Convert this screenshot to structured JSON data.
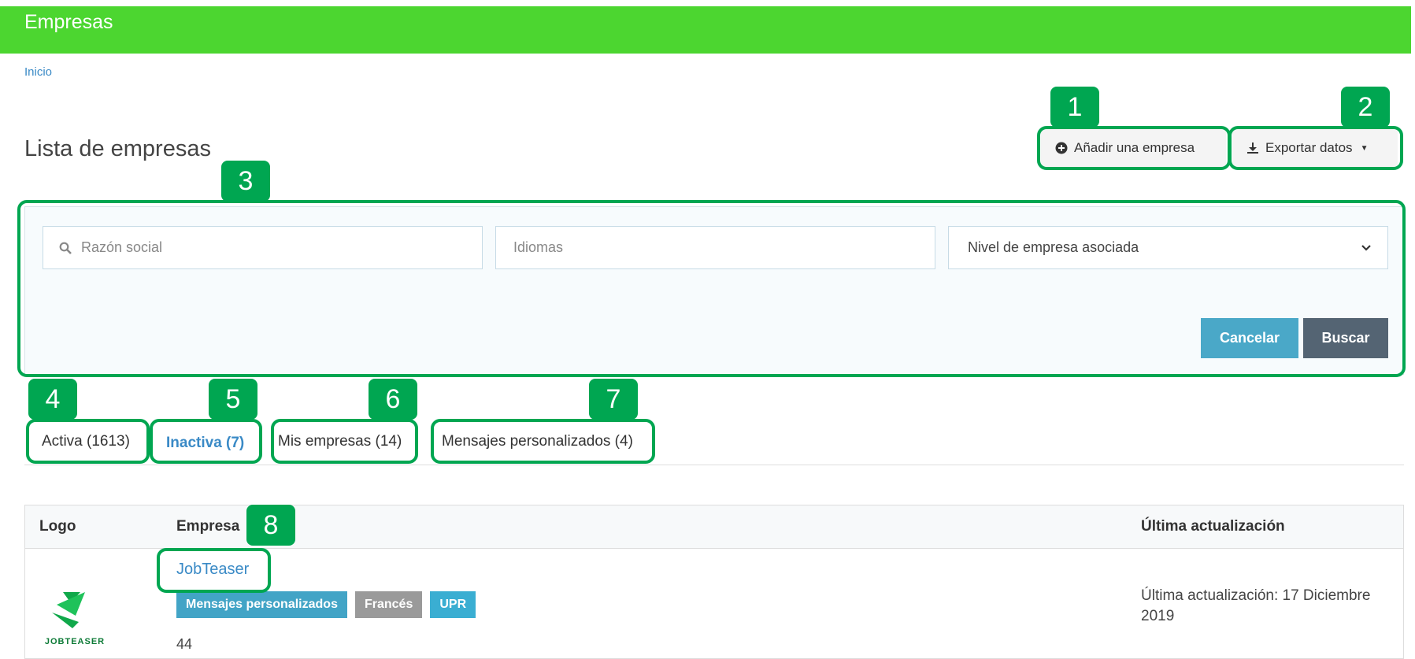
{
  "header": {
    "title": "Empresas"
  },
  "breadcrumb": {
    "home": "Inicio"
  },
  "page": {
    "title": "Lista de empresas"
  },
  "actions": {
    "add_label": "Añadir una empresa",
    "export_label": "Exportar datos"
  },
  "filters": {
    "search_placeholder": "Razón social",
    "languages_placeholder": "Idiomas",
    "level_placeholder": "Nivel de empresa asociada",
    "cancel_label": "Cancelar",
    "search_label": "Buscar"
  },
  "tabs": [
    {
      "label": "Activa (1613)"
    },
    {
      "label": "Inactiva (7)"
    },
    {
      "label": "Mis empresas (14)"
    },
    {
      "label": "Mensajes personalizados (4)"
    }
  ],
  "table": {
    "headers": {
      "logo": "Logo",
      "company": "Empresa",
      "updated": "Última actualización"
    },
    "rows": [
      {
        "company": "JobTeaser",
        "logo_text": "JOBTEASER",
        "badges": [
          "Mensajes personalizados",
          "Francés",
          "UPR"
        ],
        "count": "44",
        "updated": "Última actualización: 17 Diciembre 2019"
      }
    ]
  },
  "annotations": [
    "1",
    "2",
    "3",
    "4",
    "5",
    "6",
    "7",
    "8"
  ],
  "colors": {
    "header_bg": "#4cd630",
    "accent_link": "#3a8ac6",
    "marker": "#00a651",
    "cancel": "#4aa8c8",
    "search": "#546473"
  }
}
